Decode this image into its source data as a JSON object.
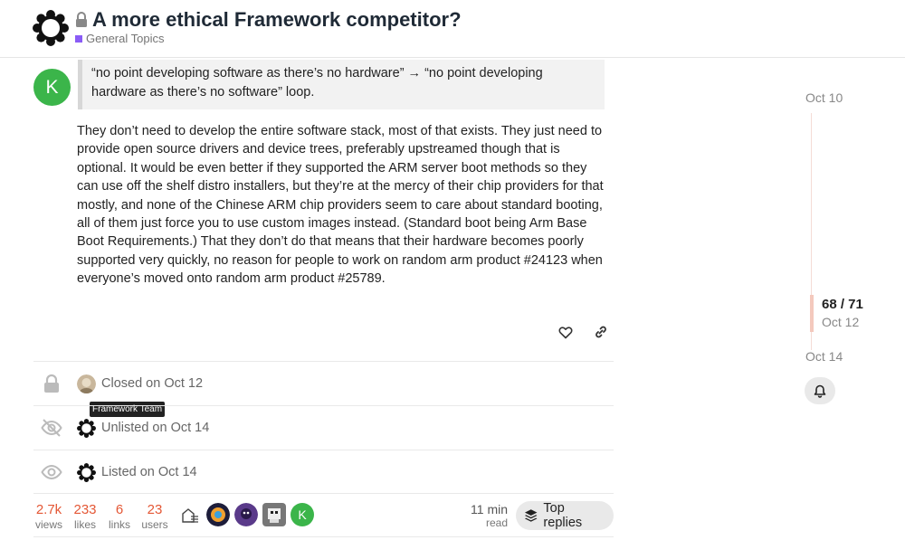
{
  "header": {
    "title": "A more ethical Framework competitor?",
    "category": "General Topics",
    "category_color": "#8a5cf6"
  },
  "post": {
    "author_initial": "K",
    "avatar_color": "#3bb54a",
    "quote": "“no point developing software as there’s no hardware” → “no point developing hardware as there’s no software” loop.",
    "body": "They don’t need to develop the entire software stack, most of that exists. They just need to provide open source drivers and device trees, preferably upstreamed though that is optional. It would be even better if they supported the ARM server boot methods so they can use off the shelf distro installers, but they’re at the mercy of their chip providers for that mostly, and none of the Chinese ARM chip providers seem to care about standard booting, all of them just force you to use custom images instead. (Standard boot being Arm Base Boot Requirements.) That they don’t do that means that their hardware becomes poorly supported very quickly, no reason for people to work on random arm product #24123 when everyone’s moved onto random arm product #25789."
  },
  "small_actions": [
    {
      "text": "Closed on Oct 12",
      "icon": "lock-icon"
    },
    {
      "text": "Unlisted on Oct 14",
      "icon": "eye-slash-icon"
    },
    {
      "text": "Listed on Oct 14",
      "icon": "eye-icon"
    }
  ],
  "tooltip": "Framework Team",
  "summary": {
    "views": {
      "num": "2.7k",
      "label": "views"
    },
    "likes": {
      "num": "233",
      "label": "likes"
    },
    "links": {
      "num": "6",
      "label": "links"
    },
    "users": {
      "num": "23",
      "label": "users"
    },
    "read_time": {
      "num": "11 min",
      "label": "read"
    },
    "top_replies": "Top replies",
    "accent_color": "#e45735"
  },
  "timeline": {
    "start_date": "Oct 10",
    "position": "68 / 71",
    "position_date": "Oct 12",
    "end_date": "Oct 14"
  }
}
